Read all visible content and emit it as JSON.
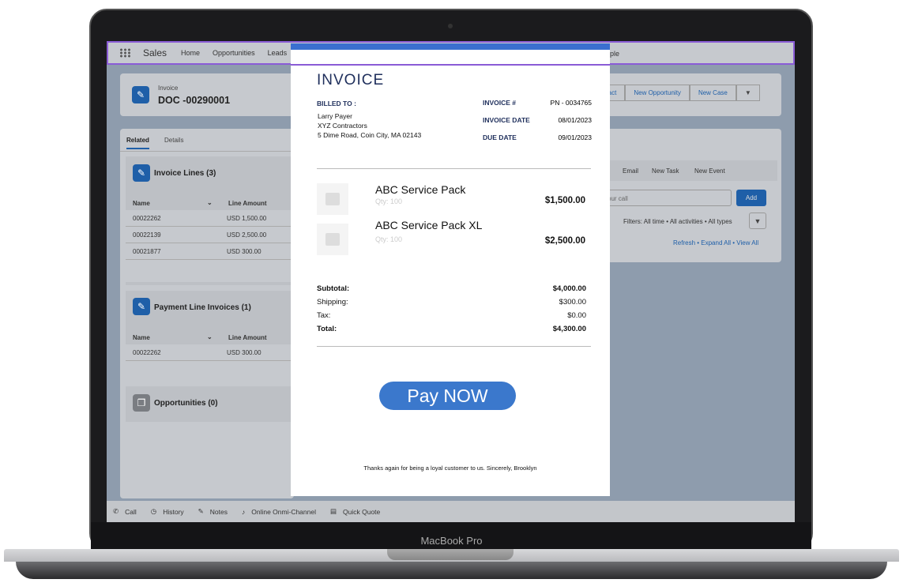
{
  "device": {
    "label": "MacBook Pro"
  },
  "nav": {
    "app": "Sales",
    "items": [
      "Home",
      "Opportunities",
      "Leads"
    ],
    "trailing": "ople"
  },
  "record": {
    "type": "Invoice",
    "name": "DOC -00290001",
    "actions": [
      "ntact",
      "New Opportunity",
      "New Case"
    ]
  },
  "tabs": [
    "Related",
    "Details"
  ],
  "invoice_lines": {
    "title": "Invoice Lines (3)",
    "col_name": "Name",
    "col_amount": "Line Amount",
    "rows": [
      {
        "name": "00022262",
        "amount": "USD 1,500.00"
      },
      {
        "name": "00022139",
        "amount": "USD 2,500.00"
      },
      {
        "name": "00021877",
        "amount": "USD 300.00"
      }
    ]
  },
  "payment_lines": {
    "title": "Payment Line Invoices (1)",
    "col_name": "Name",
    "col_amount": "Line Amount",
    "rows": [
      {
        "name": "00022262",
        "amount": "USD 300.00"
      }
    ]
  },
  "opportunities": {
    "title": "Opportunities (0)"
  },
  "activity": {
    "tabs": [
      "Email",
      "New Task",
      "New Event"
    ],
    "input_placeholder": "our call",
    "add": "Add",
    "filters": "Filters: All time • All activities • All types",
    "links": "Refresh • Expand All • View All"
  },
  "invoice": {
    "title": "INVOICE",
    "billed_to_label": "BILLED TO :",
    "billed_to": [
      "Larry Payer",
      "XYZ Contractors",
      "5 Dime Road, Coin City, MA 02143"
    ],
    "meta": [
      {
        "label": "INVOICE #",
        "value": "PN - 0034765"
      },
      {
        "label": "INVOICE DATE",
        "value": "08/01/2023"
      },
      {
        "label": "DUE DATE",
        "value": "09/01/2023"
      }
    ],
    "items": [
      {
        "name": "ABC Service Pack",
        "qty": "Qty: 100",
        "price": "$1,500.00"
      },
      {
        "name": "ABC Service Pack XL",
        "qty": "Qty: 100",
        "price": "$2,500.00"
      }
    ],
    "totals": [
      {
        "label": "Subtotal:",
        "value": "$4,000.00"
      },
      {
        "label": "Shipping:",
        "value": "$300.00"
      },
      {
        "label": "Tax:",
        "value": "$0.00"
      },
      {
        "label": "Total:",
        "value": "$4,300.00"
      }
    ],
    "pay_button": "Pay NOW",
    "footer": "Thanks again for being a loyal customer to us. Sincerely, Brooklyn"
  },
  "utility": [
    "Call",
    "History",
    "Notes",
    "Online Onmi-Channel",
    "Quick Quote"
  ],
  "colors": {
    "accent": "#3b78cc",
    "brand": "#1f5fa8",
    "navy": "#1f2f5c",
    "highlight": "#8a5cd6"
  }
}
